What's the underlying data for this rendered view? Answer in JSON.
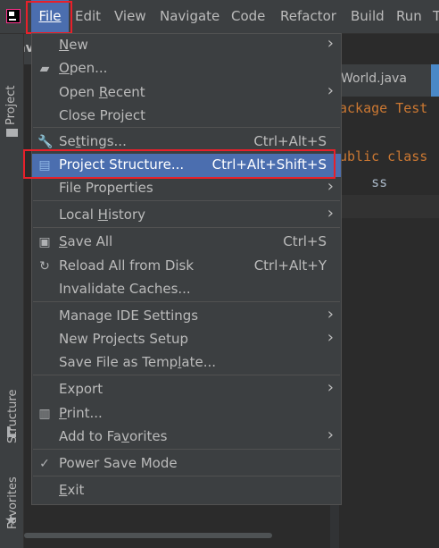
{
  "menubar": {
    "items": [
      {
        "label": "File",
        "active": true
      },
      {
        "label": "Edit"
      },
      {
        "label": "View"
      },
      {
        "label": "Navigate"
      },
      {
        "label": "Code"
      },
      {
        "label": "Refactor"
      },
      {
        "label": "Build"
      },
      {
        "label": "Run"
      },
      {
        "label": "T"
      }
    ]
  },
  "left_toolbar": {
    "project_tab": "Project",
    "structure_tab": "Structure",
    "favorites_tab": "Favorites"
  },
  "project_panel": {
    "header": "Jav"
  },
  "editor": {
    "tab": "World.java",
    "lines": [
      "ackage Test",
      "",
      "ublic class",
      "    ss",
      ""
    ]
  },
  "file_menu": {
    "items": [
      {
        "label_pre": "",
        "mnemonic": "N",
        "label_post": "ew",
        "shortcut": "",
        "submenu": true,
        "icon": ""
      },
      {
        "label_pre": "",
        "mnemonic": "O",
        "label_post": "pen...",
        "shortcut": "",
        "submenu": false,
        "icon": "folder-open-icon"
      },
      {
        "label_pre": "Open ",
        "mnemonic": "R",
        "label_post": "ecent",
        "shortcut": "",
        "submenu": true,
        "icon": ""
      },
      {
        "label_pre": "Close Project",
        "mnemonic": "",
        "label_post": "",
        "shortcut": "",
        "submenu": false,
        "icon": ""
      },
      {
        "label_pre": "Se",
        "mnemonic": "t",
        "label_post": "tings...",
        "shortcut": "Ctrl+Alt+S",
        "submenu": false,
        "icon": "wrench-icon"
      },
      {
        "label_pre": "Project Structure...",
        "mnemonic": "",
        "label_post": "",
        "shortcut": "Ctrl+Alt+Shift+S",
        "submenu": false,
        "icon": "project-structure-icon",
        "highlighted": true
      },
      {
        "label_pre": "File Properties",
        "mnemonic": "",
        "label_post": "",
        "shortcut": "",
        "submenu": true,
        "icon": ""
      },
      {
        "label_pre": "Local ",
        "mnemonic": "H",
        "label_post": "istory",
        "shortcut": "",
        "submenu": true,
        "icon": ""
      },
      {
        "label_pre": "",
        "mnemonic": "S",
        "label_post": "ave All",
        "shortcut": "Ctrl+S",
        "submenu": false,
        "icon": "save-icon"
      },
      {
        "label_pre": "Reload All from Disk",
        "mnemonic": "",
        "label_post": "",
        "shortcut": "Ctrl+Alt+Y",
        "submenu": false,
        "icon": "reload-icon"
      },
      {
        "label_pre": "Invalidate Caches...",
        "mnemonic": "",
        "label_post": "",
        "shortcut": "",
        "submenu": false,
        "icon": ""
      },
      {
        "label_pre": "Manage IDE Settings",
        "mnemonic": "",
        "label_post": "",
        "shortcut": "",
        "submenu": true,
        "icon": ""
      },
      {
        "label_pre": "New Projects Setup",
        "mnemonic": "",
        "label_post": "",
        "shortcut": "",
        "submenu": true,
        "icon": ""
      },
      {
        "label_pre": "Save File as Temp",
        "mnemonic": "l",
        "label_post": "ate...",
        "shortcut": "",
        "submenu": false,
        "icon": ""
      },
      {
        "label_pre": "Export",
        "mnemonic": "",
        "label_post": "",
        "shortcut": "",
        "submenu": true,
        "icon": ""
      },
      {
        "label_pre": "",
        "mnemonic": "P",
        "label_post": "rint...",
        "shortcut": "",
        "submenu": false,
        "icon": "print-icon"
      },
      {
        "label_pre": "Add to Fa",
        "mnemonic": "v",
        "label_post": "orites",
        "shortcut": "",
        "submenu": true,
        "icon": ""
      },
      {
        "label_pre": "Power Save Mode",
        "mnemonic": "",
        "label_post": "",
        "shortcut": "",
        "submenu": false,
        "icon": "checkmark-icon"
      },
      {
        "label_pre": "",
        "mnemonic": "E",
        "label_post": "xit",
        "shortcut": "",
        "submenu": false,
        "icon": ""
      }
    ]
  },
  "colors": {
    "highlight": "#4b6eaf",
    "annotation_box": "#e8202a",
    "menu_bg": "#3c3f41"
  }
}
